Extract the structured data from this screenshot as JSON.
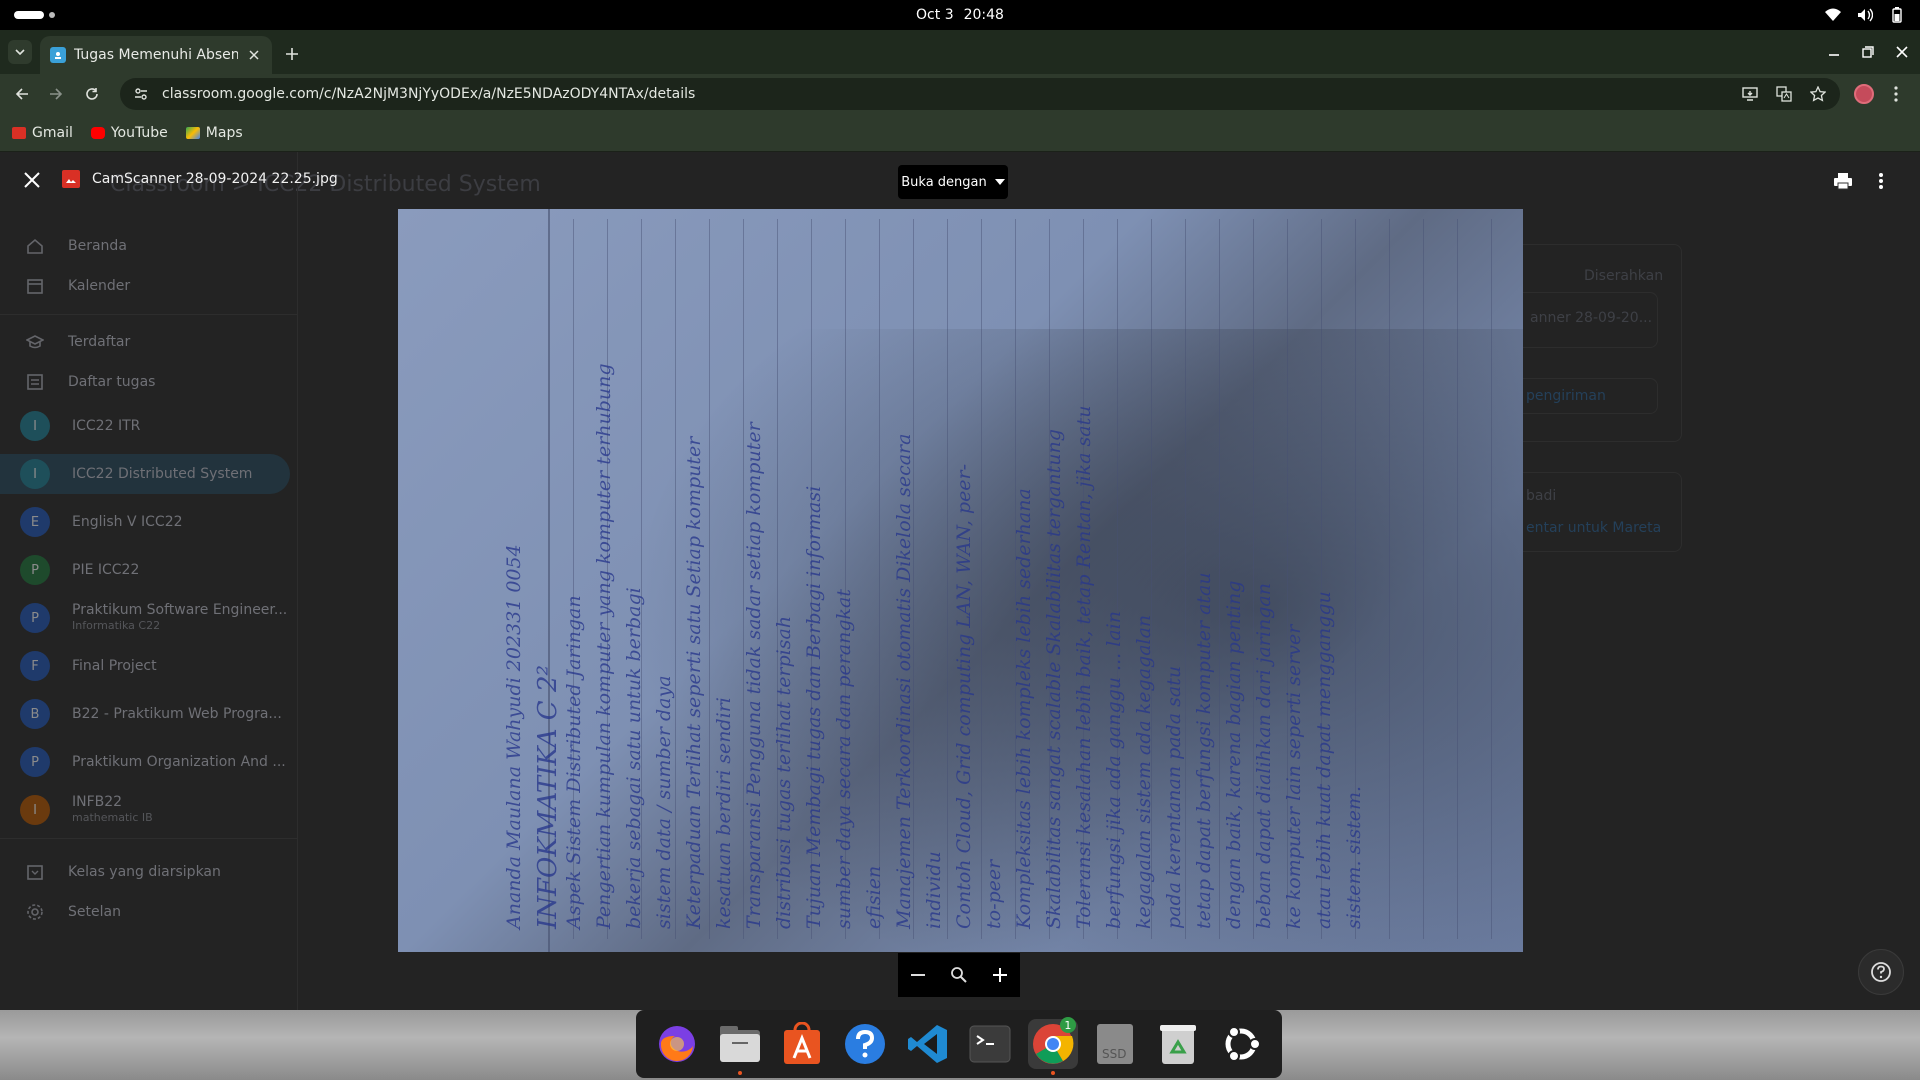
{
  "system": {
    "date": "Oct 3",
    "time": "20:48"
  },
  "browser": {
    "tab_title": "Tugas Memenuhi Absens",
    "url": "classroom.google.com/c/NzA2NjM3NjYyODEx/a/NzE5NDAzODY4NTAx/details",
    "bookmarks": [
      {
        "label": "Gmail",
        "color": "#d93025"
      },
      {
        "label": "YouTube",
        "color": "#ff0000"
      },
      {
        "label": "Maps",
        "color": "#34a853"
      }
    ]
  },
  "classroom": {
    "page_title": "Classroom > ICC22 Distributed System",
    "sidebar": {
      "home": "Beranda",
      "calendar": "Kalender",
      "enrolled": "Terdaftar",
      "todo": "Daftar tugas",
      "classes": [
        {
          "initial": "I",
          "name": "ICC22 ITR",
          "sub": "",
          "color": "#1e4f5a"
        },
        {
          "initial": "I",
          "name": "ICC22 Distributed System",
          "sub": "",
          "color": "#1e4f5a"
        },
        {
          "initial": "E",
          "name": "English V ICC22",
          "sub": "",
          "color": "#1f3a6b"
        },
        {
          "initial": "P",
          "name": "PIE ICC22",
          "sub": "",
          "color": "#1e4a2c"
        },
        {
          "initial": "P",
          "name": "Praktikum Software Engineer...",
          "sub": "Informatika C22",
          "color": "#1f3a6b"
        },
        {
          "initial": "F",
          "name": "Final Project",
          "sub": "",
          "color": "#1f3a6b"
        },
        {
          "initial": "B",
          "name": "B22 - Praktikum Web Progra...",
          "sub": "",
          "color": "#1f3a6b"
        },
        {
          "initial": "P",
          "name": "Praktikum Organization And ...",
          "sub": "",
          "color": "#1f3a6b"
        },
        {
          "initial": "I",
          "name": "INFB22",
          "sub": "mathematic IB",
          "color": "#6a3a0e"
        }
      ],
      "archived": "Kelas yang diarsipkan",
      "settings": "Setelan"
    },
    "right_panel": {
      "status": "Diserahkan",
      "attachment": "anner 28-09-20...",
      "action": "pengiriman",
      "private_title": "badi",
      "private_link": "entar untuk Mareta"
    }
  },
  "viewer": {
    "filename": "CamScanner 28-09-2024 22.25.jpg",
    "open_with": "Buka dengan",
    "zoom_out": "−",
    "zoom_in": "+"
  },
  "document": {
    "lines": [
      "Ananda Maulana Wahyudi  202331 0054",
      "INFOKMATIKA C 2²",
      "Aspek          Sistem Distributed          Jaringan",
      "Pengertian   kumpulan komputer yang   komputer terhubung",
      "bekerja sebagai satu   untuk berbagi",
      "sistem                                   data / sumber daya",
      "Keterpaduan  Terlihat seperti satu   Setiap komputer",
      "kesatuan                                 berdiri sendiri",
      "Transparansi  Pengguna tidak sadar   setiap komputer",
      "distribusi tugas                    terlihat terpisah",
      "Tujuan        Membagi tugas dan      Berbagi informasi",
      "sumber daya secara                  dan perangkat",
      "efisien",
      "Manajemen  Terkoordinasi otomatis   Dikelola secara",
      "individu",
      "Contoh        Cloud, Grid computing    LAN, WAN, peer-",
      "to-peer",
      "Kompleksitas  lebih kompleks           lebih sederhana",
      "Skalabilitas   sangat scalable           Skalabilitas tergantung",
      "Toleransi kesalahan  lebih baik, tetap   Rentan, jika satu",
      "berfungsi jika ada   ganggu ... lain",
      "kegagalan sistem    ada kegagalan",
      "pada kerentanan    pada satu",
      "tetap dapat berfungsi   komputer atau",
      "dengan baik, karena   bagian penting",
      "beban dapat dialihkan   dari jaringan",
      "ke komputer lain    seperti server",
      "atau lebih kuat      dapat mengganggu",
      "sistem.             sistem."
    ]
  },
  "dock": {
    "apps": [
      "Firefox",
      "Files",
      "App Center",
      "Help",
      "VS Code",
      "Terminal",
      "Chrome",
      "SSD",
      "Trash",
      "Ubuntu"
    ],
    "chrome_badge": "1"
  }
}
